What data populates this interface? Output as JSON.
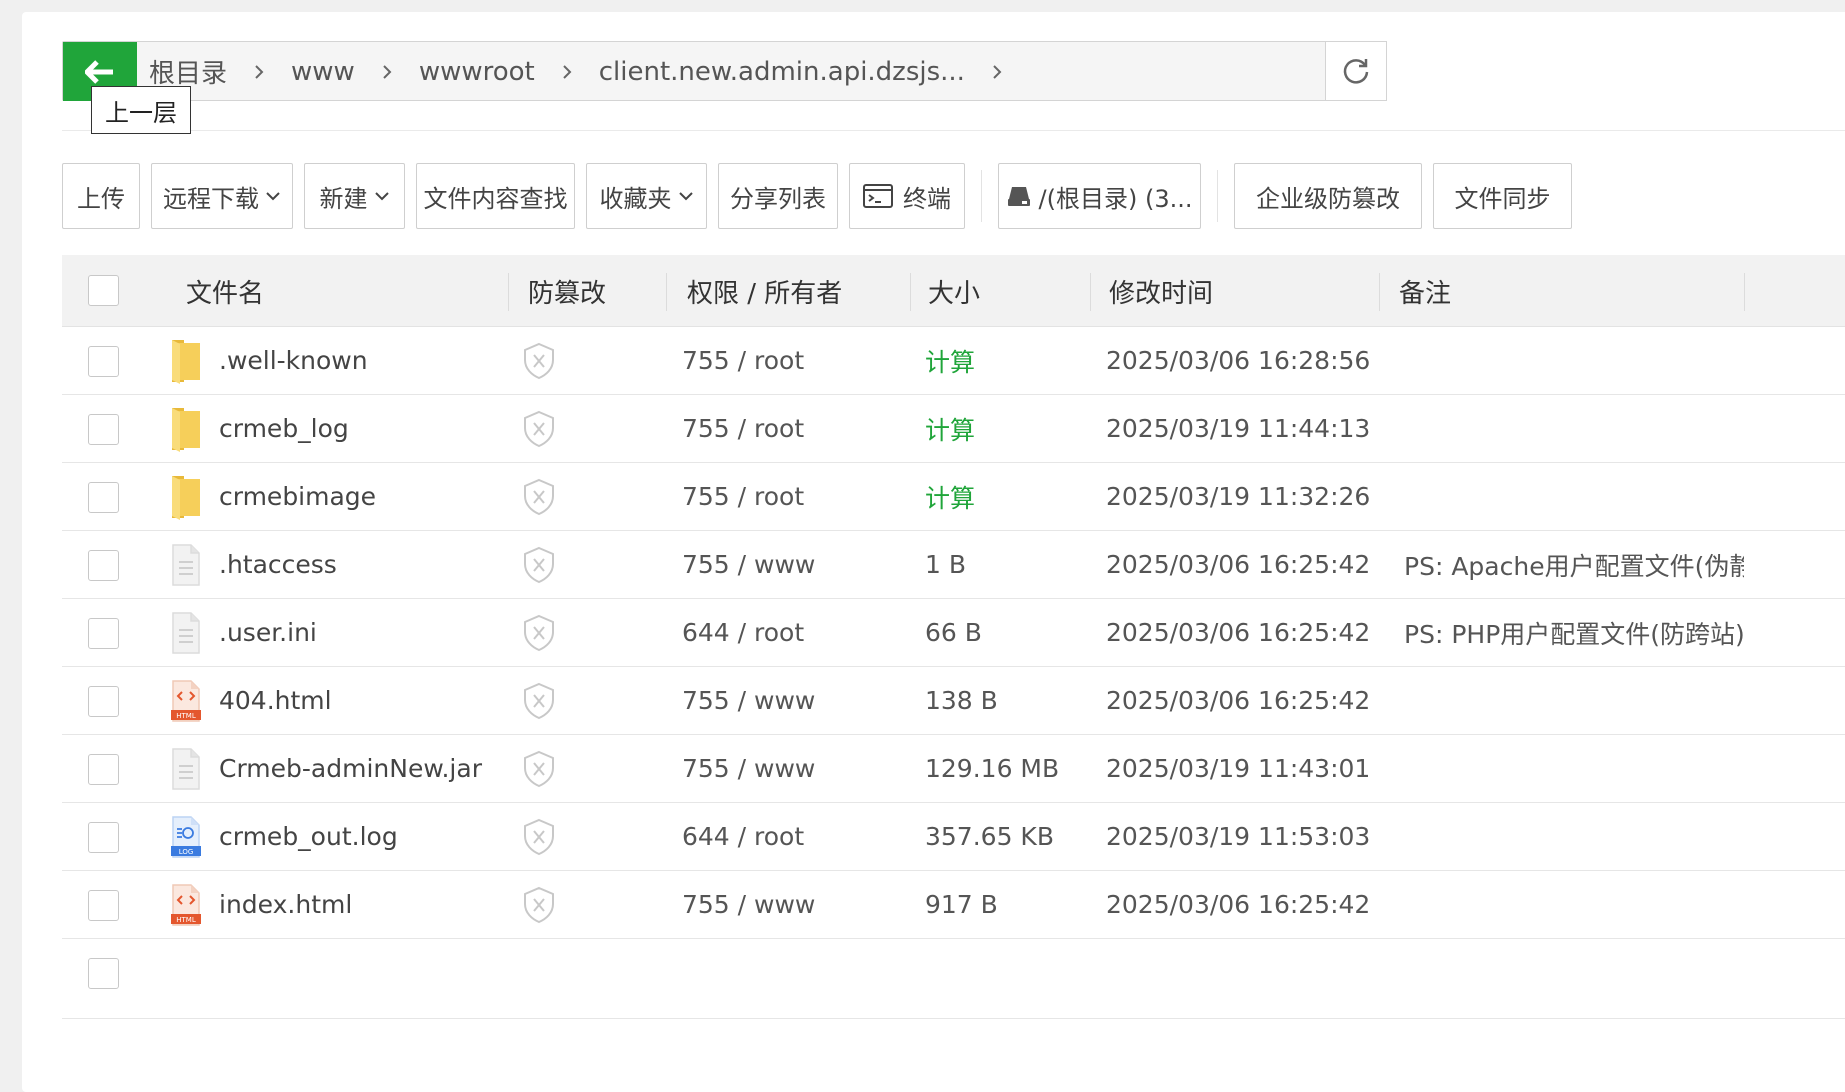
{
  "pathbar": {
    "tooltip": "上一层",
    "crumbs": [
      "根目录",
      "www",
      "wwwroot",
      "client.new.admin.api.dzsjs..."
    ]
  },
  "toolbar": {
    "upload": "上传",
    "remote_download": "远程下载",
    "new": "新建",
    "content_search": "文件内容查找",
    "favorites": "收藏夹",
    "share_list": "分享列表",
    "terminal": "终端",
    "disk": "/(根目录) (3...",
    "tamper_proof": "企业级防篡改",
    "file_sync": "文件同步"
  },
  "table": {
    "headers": {
      "name": "文件名",
      "tamper": "防篡改",
      "perm_owner": "权限 / 所有者",
      "size": "大小",
      "mtime": "修改时间",
      "note": "备注"
    },
    "rows": [
      {
        "icon": "folder-icon",
        "name": ".well-known",
        "perm": "755 / root",
        "size": "计算",
        "size_is_calc": true,
        "mtime": "2025/03/06 16:28:56",
        "note": ""
      },
      {
        "icon": "folder-icon",
        "name": "crmeb_log",
        "perm": "755 / root",
        "size": "计算",
        "size_is_calc": true,
        "mtime": "2025/03/19 11:44:13",
        "note": ""
      },
      {
        "icon": "folder-icon",
        "name": "crmebimage",
        "perm": "755 / root",
        "size": "计算",
        "size_is_calc": true,
        "mtime": "2025/03/19 11:32:26",
        "note": ""
      },
      {
        "icon": "file-icon",
        "name": ".htaccess",
        "perm": "755 / www",
        "size": "1 B",
        "size_is_calc": false,
        "mtime": "2025/03/06 16:25:42",
        "note": "PS: Apache用户配置文件(伪静态"
      },
      {
        "icon": "file-icon",
        "name": ".user.ini",
        "perm": "644 / root",
        "size": "66 B",
        "size_is_calc": false,
        "mtime": "2025/03/06 16:25:42",
        "note": "PS: PHP用户配置文件(防跨站)!"
      },
      {
        "icon": "html-file-icon",
        "name": "404.html",
        "perm": "755 / www",
        "size": "138 B",
        "size_is_calc": false,
        "mtime": "2025/03/06 16:25:42",
        "note": ""
      },
      {
        "icon": "file-icon",
        "name": "Crmeb-adminNew.jar",
        "perm": "755 / www",
        "size": "129.16 MB",
        "size_is_calc": false,
        "mtime": "2025/03/19 11:43:01",
        "note": ""
      },
      {
        "icon": "log-file-icon",
        "name": "crmeb_out.log",
        "perm": "644 / root",
        "size": "357.65 KB",
        "size_is_calc": false,
        "mtime": "2025/03/19 11:53:03",
        "note": ""
      },
      {
        "icon": "html-file-icon",
        "name": "index.html",
        "perm": "755 / www",
        "size": "917 B",
        "size_is_calc": false,
        "mtime": "2025/03/06 16:25:42",
        "note": ""
      }
    ]
  },
  "colors": {
    "accent": "#20a53a",
    "folder": "#f6cf5a"
  }
}
